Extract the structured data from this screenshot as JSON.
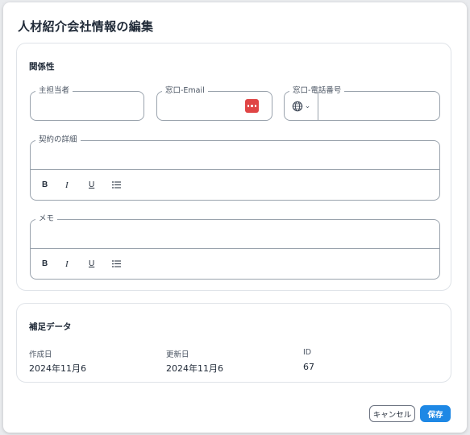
{
  "dialog": {
    "title": "人材紹介会社情報の編集"
  },
  "relations": {
    "heading": "関係性",
    "tanto": {
      "label": "主担当者",
      "value": ""
    },
    "email": {
      "label": "窓口-Email",
      "value": "",
      "icon": "password-manager-icon"
    },
    "tel": {
      "label": "窓口-電話番号",
      "value": "",
      "country_icon": "globe-icon"
    },
    "keiyaku": {
      "label": "契約の詳細",
      "value": ""
    },
    "memo": {
      "label": "メモ",
      "value": ""
    },
    "toolbar": {
      "bold": "B",
      "italic": "I",
      "underline": "U",
      "list_icon": "bulleted-list-icon"
    }
  },
  "supplement": {
    "heading": "補足データ",
    "created": {
      "label": "作成日",
      "value": "2024年11月6"
    },
    "updated": {
      "label": "更新日",
      "value": "2024年11月6"
    },
    "id": {
      "label": "ID",
      "value": "67"
    }
  },
  "footer": {
    "cancel_label": "キャンセル",
    "save_label": "保存",
    "save_color": "#1e88e5"
  },
  "colors": {
    "password_icon": "#e04545"
  }
}
